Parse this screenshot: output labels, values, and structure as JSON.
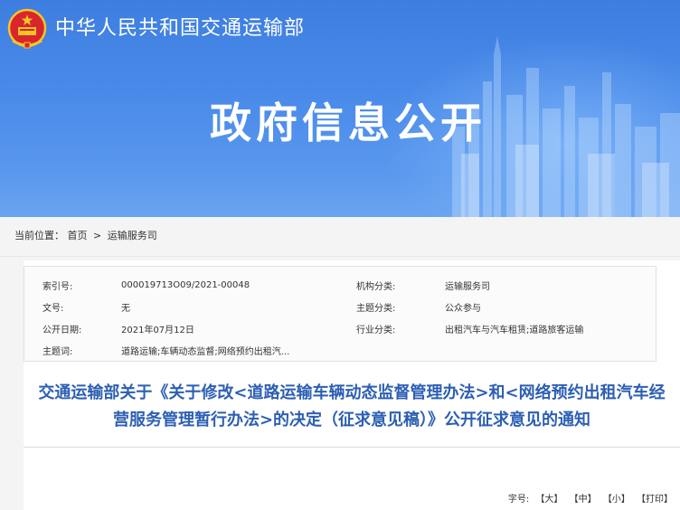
{
  "header": {
    "ministry_name": "中华人民共和国交通运输部",
    "banner_title": "政府信息公开"
  },
  "breadcrumb": {
    "prefix": "当前位置：",
    "items": [
      "首页",
      "运输服务司"
    ],
    "separator": ">"
  },
  "metadata": {
    "rows": [
      {
        "k1": "索引号:",
        "v1": "000019713O09/2021-00048",
        "k2": "机构分类:",
        "v2": "运输服务司"
      },
      {
        "k1": "文号:",
        "v1": "无",
        "k2": "主题分类:",
        "v2": "公众参与"
      },
      {
        "k1": "公开日期:",
        "v1": "2021年07月12日",
        "k2": "行业分类:",
        "v2": "出租汽车与汽车租赁;道路旅客运输"
      },
      {
        "k1": "主题词:",
        "v1": "道路运输;车辆动态监督;网络预约出租汽...",
        "k2": "",
        "v2": ""
      }
    ]
  },
  "document": {
    "title": "交通运输部关于《关于修改<道路运输车辆动态监督管理办法>和<网络预约出租汽车经营服务管理暂行办法>的决定（征求意见稿）》公开征求意见的通知"
  },
  "font_size": {
    "label": "字号:",
    "options": [
      "【大】",
      "【中】",
      "【小】",
      "【打印】"
    ]
  },
  "colors": {
    "banner_blue": "#4a8bea",
    "title_blue": "#2c5fb3",
    "emblem_red": "#d8262c",
    "emblem_gold": "#f5c526"
  }
}
